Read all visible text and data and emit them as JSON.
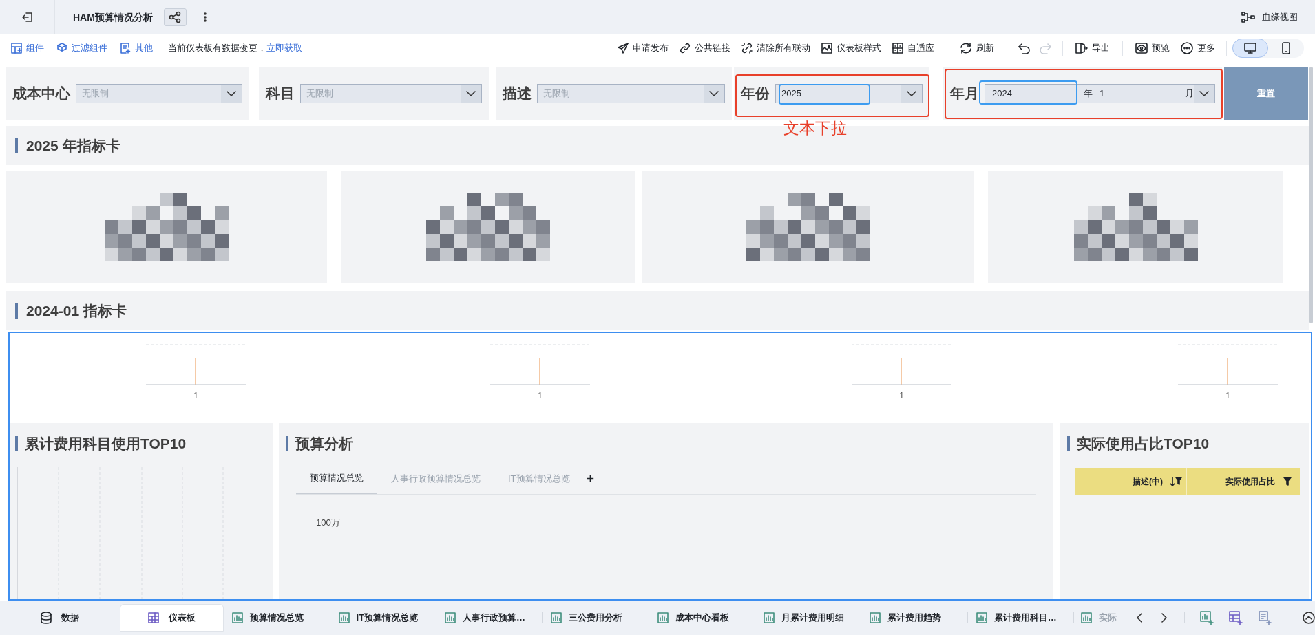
{
  "header": {
    "title": "HAM预算情况分析",
    "lineage": "血缘视图"
  },
  "toolbar_left": [
    {
      "label": "组件"
    },
    {
      "label": "过滤组件"
    },
    {
      "label": "其他"
    }
  ],
  "notice": {
    "text": "当前仪表板有数据变更，",
    "link": "立即获取"
  },
  "toolbar_right": [
    [
      {
        "kind": "text_button",
        "label": "申请发布"
      },
      {
        "kind": "text_button",
        "label": "公共链接"
      },
      {
        "kind": "text_button",
        "label": "清除所有联动"
      },
      {
        "kind": "text_button",
        "label": "仪表板样式"
      },
      {
        "kind": "text_button",
        "label": "自适应"
      }
    ],
    [
      {
        "kind": "text_button",
        "label": "刷新"
      }
    ],
    [
      {
        "kind": "icon_button",
        "disabled": false
      },
      {
        "kind": "icon_button",
        "disabled": true
      }
    ],
    [
      {
        "kind": "text_button",
        "label": "导出"
      }
    ],
    [
      {
        "kind": "text_button",
        "label": "预览"
      },
      {
        "kind": "text_button",
        "label": "更多"
      }
    ]
  ],
  "view_modes": [
    {
      "selected": true
    },
    {
      "selected": false
    }
  ],
  "filters": [
    {
      "kind": "select",
      "label": "成本中心",
      "placeholder": "无限制"
    },
    {
      "kind": "select",
      "label": "科目",
      "placeholder": "无限制"
    },
    {
      "kind": "select",
      "label": "描述",
      "placeholder": "无限制"
    },
    {
      "kind": "select",
      "label": "年份",
      "value": "2025"
    },
    {
      "kind": "year_month",
      "label": "年月",
      "year": "2024",
      "year_unit": "年",
      "month": "1",
      "month_unit": "月"
    }
  ],
  "reset_button": "重置",
  "annotation": "文本下拉",
  "sections": [
    {
      "title": "2025 年指标卡"
    },
    {
      "title": "2024-01 指标卡"
    }
  ],
  "kpi_charts": [
    {
      "label": "1"
    },
    {
      "label": "1"
    },
    {
      "label": "1"
    },
    {
      "label": "1"
    }
  ],
  "panels": {
    "left": {
      "title": "累计费用科目使用TOP10"
    },
    "middle": {
      "title": "预算分析",
      "tabs": [
        {
          "label": "预算情况总览",
          "selected": true
        },
        {
          "label": "人事行政预算情况总览",
          "selected": false
        },
        {
          "label": "IT预算情况总览",
          "selected": false
        }
      ],
      "add": "+",
      "axis_label": "100万"
    },
    "right": {
      "title": "实际使用占比TOP10",
      "columns": [
        "描述(中)",
        "实际使用占比"
      ]
    }
  },
  "bottom_bar": {
    "fixed": [
      {
        "label": "数据",
        "selected": false
      },
      {
        "label": "仪表板",
        "selected": true
      }
    ],
    "sheets": [
      "预算情况总览",
      "IT预算情况总览",
      "人事行政预算…",
      "三公费用分析",
      "成本中心看板",
      "月累计费用明细",
      "累计费用趋势",
      "累计费用科目…",
      "实际"
    ]
  }
}
